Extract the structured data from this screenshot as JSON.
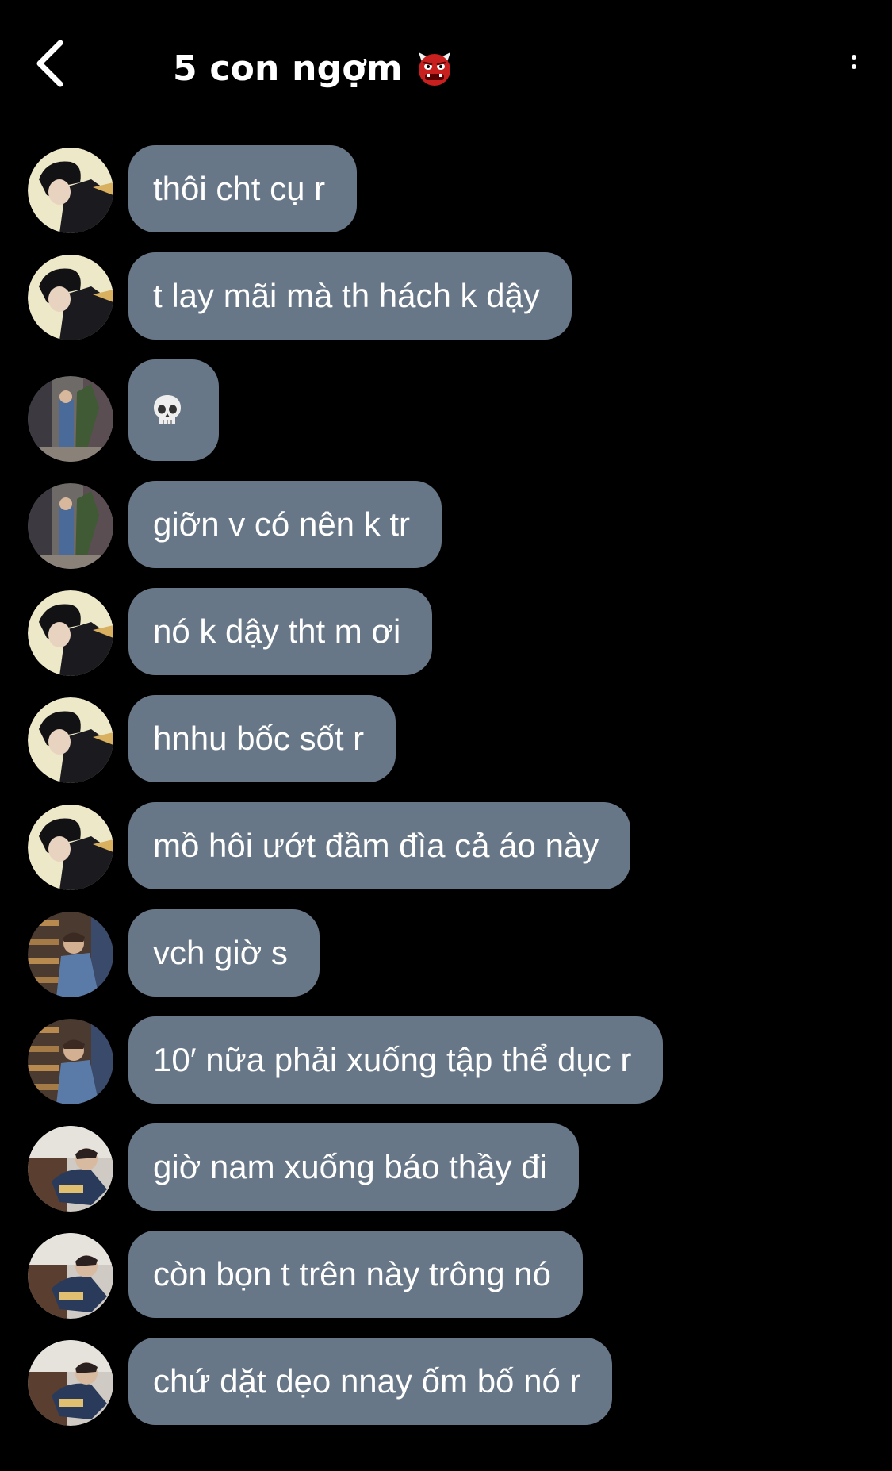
{
  "header": {
    "title": "5 con ngợm",
    "title_emoji": "ogre-emoji",
    "back_icon": "chevron-left-icon",
    "menu_icon": "more-vertical-icon"
  },
  "colors": {
    "background": "#000000",
    "bubble": "#687787",
    "text": "#ffffff"
  },
  "messages": [
    {
      "avatar": "avatar-a",
      "text": "thôi cht cụ r"
    },
    {
      "avatar": "avatar-a",
      "text": "t lay mãi mà th hách k dậy"
    },
    {
      "avatar": "avatar-b",
      "text": "",
      "emoji": "skull-emoji"
    },
    {
      "avatar": "avatar-b",
      "text": "giỡn v có nên k tr"
    },
    {
      "avatar": "avatar-a",
      "text": "nó k dậy tht m ơi"
    },
    {
      "avatar": "avatar-a",
      "text": "hnhu bốc sốt r"
    },
    {
      "avatar": "avatar-a",
      "text": "mồ hôi ướt đầm đìa cả áo này"
    },
    {
      "avatar": "avatar-c",
      "text": " vch giờ s"
    },
    {
      "avatar": "avatar-c",
      "text": "10′ nữa phải xuống tập thể dục r"
    },
    {
      "avatar": "avatar-d",
      "text": "giờ nam xuống báo thầy đi"
    },
    {
      "avatar": "avatar-d",
      "text": "còn bọn t trên này trông nó"
    },
    {
      "avatar": "avatar-d",
      "text": "chứ dặt dẹo nnay ốm bố nó r"
    }
  ]
}
